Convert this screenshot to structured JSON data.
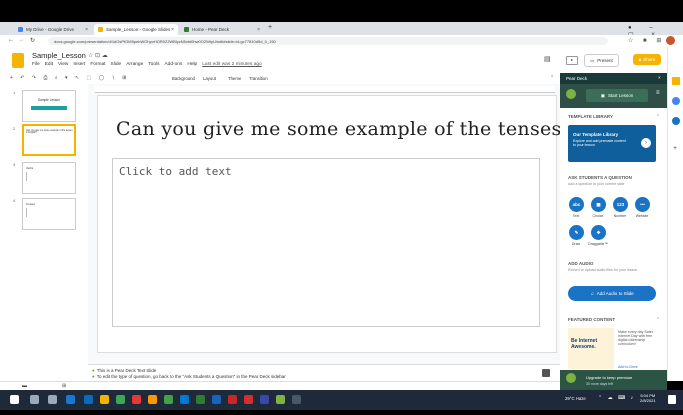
{
  "browser": {
    "tabs": [
      {
        "label": "My Drive - Google Drive",
        "color": "#4285f4"
      },
      {
        "label": "Sample_Lesson - Google Slides",
        "color": "#f4b400"
      },
      {
        "label": "Home - Pear Deck",
        "color": "#2e7d32"
      }
    ],
    "new_tab": "+",
    "url": "docs.google.com/presentation/d/1dOsPtOM9pnbWOhpvHOR0ZJWBlyzN5vbt0hw0O2WtyU/edit#slide=id.gc77810d5d_0_150"
  },
  "slides": {
    "doc_title": "Sample_Lesson",
    "last_edit": "Last edit was 2 minutes ago",
    "menu": [
      "File",
      "Edit",
      "View",
      "Insert",
      "Format",
      "Slide",
      "Arrange",
      "Tools",
      "Add-ons",
      "Help"
    ],
    "toolbar": [
      "Background",
      "Layout",
      "Theme",
      "Transition"
    ],
    "present_label": "Present",
    "share_label": "Share",
    "avatar_letter": "T"
  },
  "thumbnails": [
    {
      "num": "1",
      "title": "Sample Lesson"
    },
    {
      "num": "2",
      "title": "Can you give me some example of the tenses in English?"
    },
    {
      "num": "3",
      "title": "Verbs"
    },
    {
      "num": "4",
      "title": "Tenses"
    }
  ],
  "main_slide": {
    "title": "Can you give me some example of the tenses in english?",
    "placeholder": "Click to add text"
  },
  "notes": {
    "line1": "This is a Pear Deck Text Slide",
    "line2": "To edit the type of question, go back to the \"Ask Students a Question\" in the Pear Deck sidebar"
  },
  "peardeck": {
    "header": "Pear Deck",
    "start_lesson": "Start Lesson",
    "template_library_heading": "TEMPLATE LIBRARY",
    "template_card_title": "Our Template Library",
    "template_card_text": "Explore and add premade content to your lesson",
    "ask_heading": "ASK STUDENTS A QUESTION",
    "ask_sub": "Add a question to your current slide",
    "question_types": [
      {
        "icon": "abc",
        "label": "Text"
      },
      {
        "icon": "▦",
        "label": "Choice"
      },
      {
        "icon": "123",
        "label": "Number"
      },
      {
        "icon": "•••",
        "label": "Website"
      },
      {
        "icon": "✎",
        "label": "Draw"
      },
      {
        "icon": "✥",
        "label": "Draggable™"
      }
    ],
    "audio_heading": "ADD AUDIO",
    "audio_sub": "Record or upload audio files for your lesson",
    "audio_button": "Add Audio to Slide",
    "featured_heading": "FEATURED CONTENT",
    "featured_image_text": "Be Internet Awesome.",
    "featured_text": "Make every day Safer Internet Day with free digital citizenship curriculum!",
    "featured_link": "Add to Drive",
    "upgrade_text": "Upgrade to keep premium",
    "upgrade_sub": "30 more days left"
  },
  "taskbar": {
    "weather": "29°C Haze",
    "time": "5:04 PM",
    "date": "2/8/2021"
  }
}
